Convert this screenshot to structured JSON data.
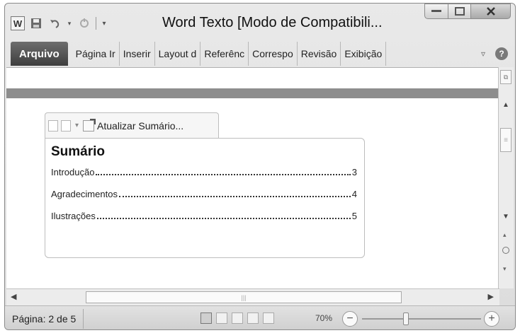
{
  "titlebar": {
    "app_icon_letter": "W",
    "title": "Word Texto [Modo de Compatibili..."
  },
  "ribbon": {
    "file_tab": "Arquivo",
    "tabs": [
      "Página Ir",
      "Inserir",
      "Layout d",
      "Referênc",
      "Correspo",
      "Revisão",
      "Exibição"
    ]
  },
  "toc": {
    "control_label": "Atualizar Sumário...",
    "heading": "Sumário",
    "entries": [
      {
        "label": "Introdução",
        "page": "3"
      },
      {
        "label": "Agradecimentos",
        "page": "4"
      },
      {
        "label": "Ilustrações",
        "page": "5"
      }
    ]
  },
  "status": {
    "page_info": "Página: 2 de 5",
    "zoom_level": "70%",
    "zoom_value_percent": 70
  },
  "icons": {
    "save": "save-icon",
    "undo": "undo-icon",
    "redo": "redo-icon",
    "customize": "customize-qat-icon",
    "help": "help-icon",
    "ribbon_collapse": "chevron-down-icon"
  }
}
